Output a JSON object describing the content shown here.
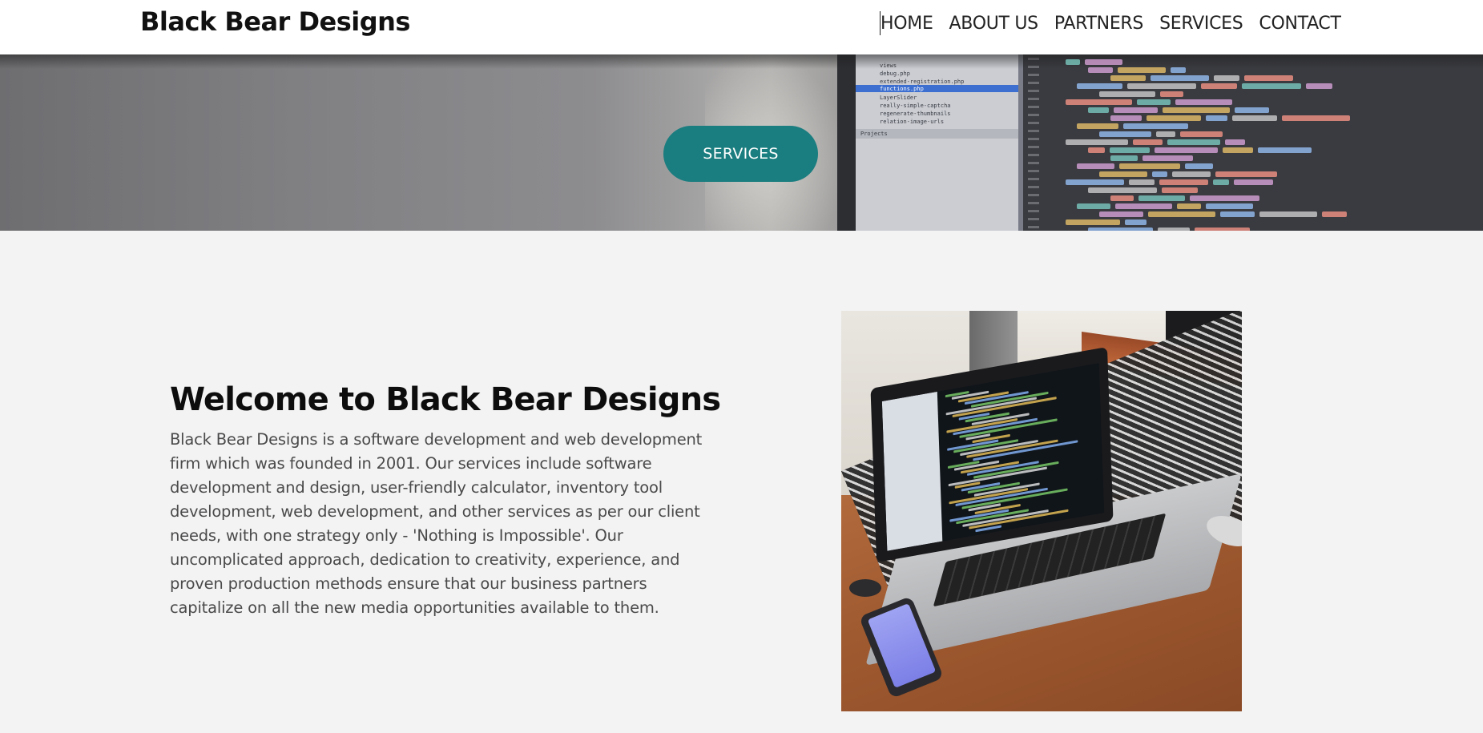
{
  "header": {
    "brand": "Black Bear Designs",
    "nav": [
      "HOME",
      "ABOUT US",
      "PARTNERS",
      "SERVICES",
      "CONTACT"
    ]
  },
  "hero": {
    "button_label": "SERVICES",
    "file_tree": [
      "views",
      "debug.php",
      "extended-registration.php",
      "functions.php",
      "LayerSlider",
      "really-simple-captcha",
      "regenerate-thumbnails",
      "relation-image-urls"
    ],
    "panel_label": "Projects"
  },
  "main": {
    "title": "Welcome to Black Bear Designs",
    "body": "Black Bear Designs is a software development and web development firm which was founded in 2001. Our services include software development and design, user-friendly calculator, inventory tool development, web development, and other services as per our client needs, with one strategy only - 'Nothing is Impossible'. Our uncomplicated approach, dedication to creativity, experience, and proven production methods ensure that our business partners capitalize on all the new media opportunities available to them."
  },
  "colors": {
    "accent": "#1a7d7f",
    "page_bg": "#f3f3f4",
    "header_bg": "#ffffff",
    "title_text": "#0d0d0d",
    "body_text": "#4a4a4a"
  },
  "images": {
    "hero_background": "code-editor-photo",
    "side_photo": "laptop-on-desk-photo"
  }
}
